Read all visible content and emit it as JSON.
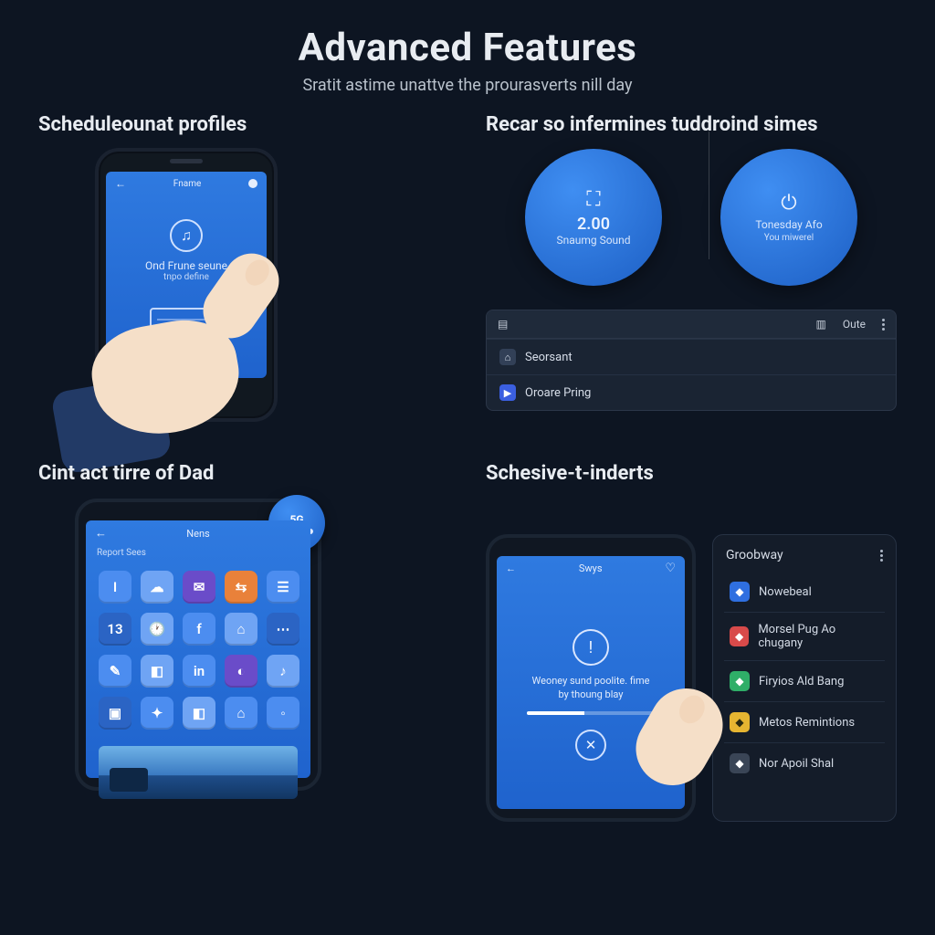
{
  "header": {
    "title": "Advanced Features",
    "subtitle": "Sratit astime unattve the prourasverts nill day"
  },
  "q1": {
    "heading": "Scheduleounat profiles",
    "phone_header_label": "Fname",
    "center_line1": "Ond Frune seune",
    "center_line2": "tnpo define"
  },
  "q2": {
    "heading": "Recar so infermines tuddroind simes",
    "circle_a": {
      "value": "2.00",
      "label": "Snaumg Sound"
    },
    "circle_b": {
      "line1": "Tonesday Afo",
      "line2": "You miwerel"
    },
    "panel_header_right": "Oute",
    "row1": "Seorsant",
    "row2": "Oroare Pring"
  },
  "q3": {
    "heading": "Cint act tirre of Dad",
    "phone_header_label": "Nens",
    "subheader": "Report Sees",
    "badge": "5G",
    "apps": [
      "I",
      "☁",
      "✉",
      "⇆",
      "☰",
      "13",
      "🕐",
      "f",
      "⌂",
      "⋯",
      "✎",
      "◧",
      "in",
      "◐",
      "♪",
      "▣",
      "✦",
      "◧",
      "⌂",
      "◦"
    ]
  },
  "q4": {
    "heading": "Schesive-t-inderts",
    "phone_header_label": "Swys",
    "body_line1": "Weoney sund poolite. fime",
    "body_line2": "by thoung blay",
    "list_title": "Groobway",
    "items": [
      {
        "color": "bl",
        "label": "Nowebeal"
      },
      {
        "color": "rd",
        "label": "Morsel Pug Ao chugany"
      },
      {
        "color": "gn",
        "label": "Firyios Ald Bang"
      },
      {
        "color": "yl",
        "label": "Metos Remintions"
      },
      {
        "color": "gy",
        "label": "Nor Apoil Shal"
      }
    ]
  }
}
